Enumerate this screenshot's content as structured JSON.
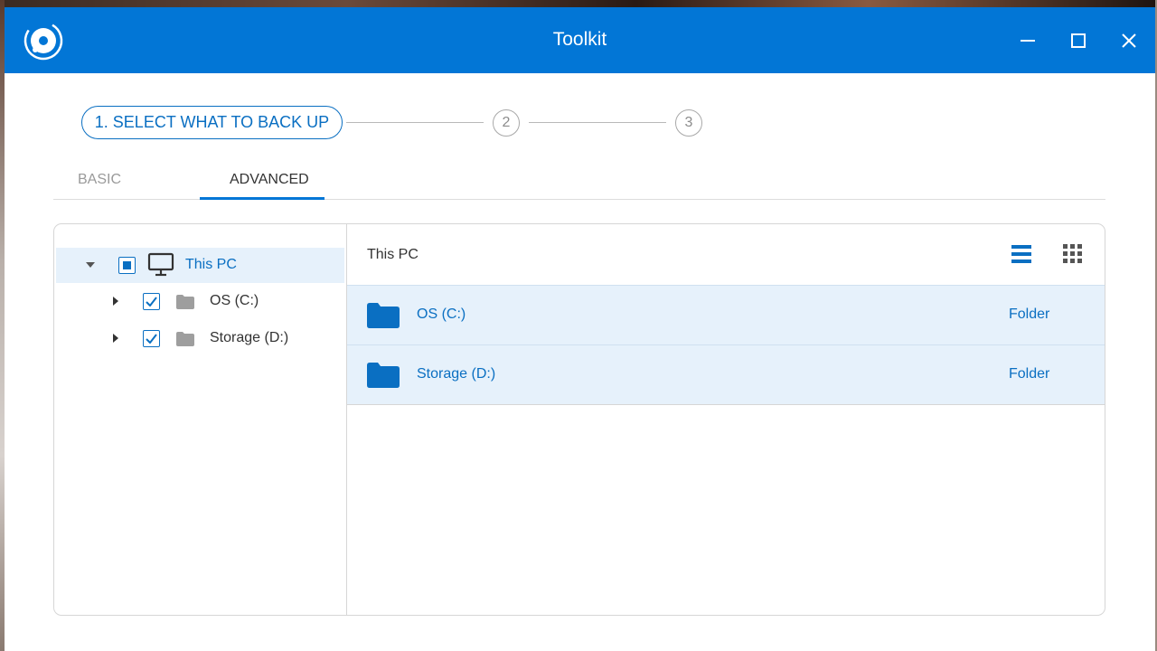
{
  "window": {
    "title": "Toolkit",
    "controls": [
      "minimize-icon",
      "maximize-icon",
      "close-icon"
    ]
  },
  "stepper": {
    "current_step_label": "1. SELECT WHAT TO BACK UP",
    "step2": "2",
    "step3": "3"
  },
  "tabs": [
    {
      "label": "BASIC",
      "active": false
    },
    {
      "label": "ADVANCED",
      "active": true
    }
  ],
  "tree": {
    "root": {
      "label": "This PC",
      "state": "partial",
      "expanded": true
    },
    "children": [
      {
        "label": "OS (C:)",
        "checked": true,
        "expanded": false
      },
      {
        "label": "Storage (D:)",
        "checked": true,
        "expanded": false
      }
    ]
  },
  "list": {
    "location": "This PC",
    "rows": [
      {
        "name": "OS (C:)",
        "type": "Folder"
      },
      {
        "name": "Storage (D:)",
        "type": "Folder"
      }
    ]
  },
  "colors": {
    "accent": "#0276d6",
    "selection": "#e6f1fb",
    "text_link": "#0a6fc2"
  }
}
